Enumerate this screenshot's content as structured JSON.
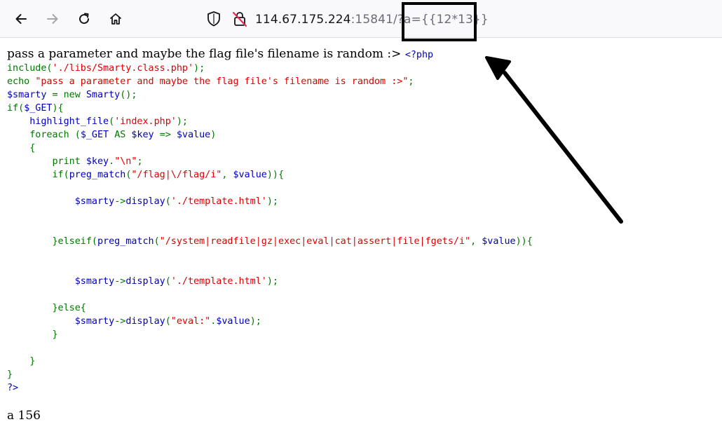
{
  "browser": {
    "url_host": "114.67.175.224",
    "url_rest": ":15841/?a={{12*13}}",
    "icons": [
      "back-icon",
      "forward-icon",
      "reload-icon",
      "home-icon",
      "shield-icon",
      "insecure-lock-icon"
    ]
  },
  "page": {
    "intro_text": "pass a parameter and maybe the flag file's filename is random :> ",
    "php_open": "<?php",
    "code_lines": [
      [
        [
          "k",
          "include("
        ],
        [
          "s",
          "'./libs/Smarty.class.php'"
        ],
        [
          "k",
          ");"
        ]
      ],
      [
        [
          "k",
          "echo "
        ],
        [
          "s",
          "\"pass a parameter and maybe the flag file's filename is random :>\""
        ],
        [
          "k",
          ";"
        ]
      ],
      [
        [
          "d",
          "$smarty "
        ],
        [
          "k",
          "= new "
        ],
        [
          "d",
          "Smarty"
        ],
        [
          "k",
          "();"
        ]
      ],
      [
        [
          "k",
          "if("
        ],
        [
          "d",
          "$_GET"
        ],
        [
          "k",
          "){"
        ]
      ],
      [
        [
          "k",
          "    "
        ],
        [
          "d",
          "highlight_file"
        ],
        [
          "k",
          "("
        ],
        [
          "s",
          "'index.php'"
        ],
        [
          "k",
          ");"
        ]
      ],
      [
        [
          "k",
          "    foreach ("
        ],
        [
          "d",
          "$_GET "
        ],
        [
          "k",
          "AS "
        ],
        [
          "d",
          "$key "
        ],
        [
          "k",
          "=> "
        ],
        [
          "d",
          "$value"
        ],
        [
          "k",
          ")"
        ]
      ],
      [
        [
          "k",
          "    {"
        ]
      ],
      [
        [
          "k",
          "        print "
        ],
        [
          "d",
          "$key"
        ],
        [
          "k",
          "."
        ],
        [
          "s",
          "\"\\n\""
        ],
        [
          "k",
          ";"
        ]
      ],
      [
        [
          "k",
          "        if("
        ],
        [
          "d",
          "preg_match"
        ],
        [
          "k",
          "("
        ],
        [
          "s",
          "\"/flag|\\/flag/i\""
        ],
        [
          "k",
          ", "
        ],
        [
          "d",
          "$value"
        ],
        [
          "k",
          "))"
        ],
        [
          "k",
          "{"
        ]
      ],
      [],
      [
        [
          "d",
          "            $smarty"
        ],
        [
          "k",
          "->"
        ],
        [
          "d",
          "display"
        ],
        [
          "k",
          "("
        ],
        [
          "s",
          "'./template.html'"
        ],
        [
          "k",
          ");"
        ]
      ],
      [],
      [],
      [
        [
          "k",
          "        }elseif("
        ],
        [
          "d",
          "preg_match"
        ],
        [
          "k",
          "("
        ],
        [
          "s",
          "\"/system|readfile|gz|exec|eval|cat|assert|file|fgets/i\""
        ],
        [
          "k",
          ", "
        ],
        [
          "d",
          "$value"
        ],
        [
          "k",
          "))"
        ],
        [
          "k",
          "{"
        ]
      ],
      [],
      [],
      [
        [
          "d",
          "            $smarty"
        ],
        [
          "k",
          "->"
        ],
        [
          "d",
          "display"
        ],
        [
          "k",
          "("
        ],
        [
          "s",
          "'./template.html'"
        ],
        [
          "k",
          ");"
        ]
      ],
      [],
      [
        [
          "k",
          "        }else{"
        ]
      ],
      [
        [
          "d",
          "            $smarty"
        ],
        [
          "k",
          "->"
        ],
        [
          "d",
          "display"
        ],
        [
          "k",
          "("
        ],
        [
          "s",
          "\"eval:\""
        ],
        [
          "k",
          "."
        ],
        [
          "d",
          "$value"
        ],
        [
          "k",
          ");"
        ]
      ],
      [
        [
          "k",
          "        }"
        ]
      ],
      [],
      [
        [
          "k",
          "    }"
        ]
      ],
      [
        [
          "k",
          "}"
        ]
      ],
      [
        [
          "d",
          "?>"
        ]
      ]
    ],
    "output_text": "a 156"
  },
  "colors": {
    "php_default": "#0000bb",
    "php_keyword": "#007700",
    "php_string": "#dd0000",
    "annotation": "#000000"
  }
}
